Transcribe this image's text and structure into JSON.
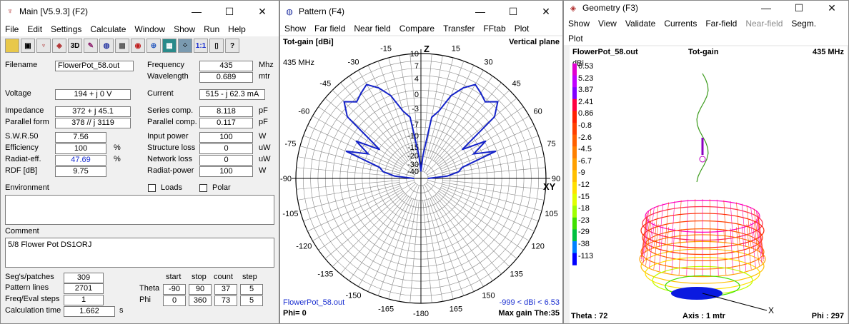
{
  "main": {
    "title": "Main [V5.9.3]   (F2)",
    "menu": [
      "File",
      "Edit",
      "Settings",
      "Calculate",
      "Window",
      "Show",
      "Run",
      "Help"
    ],
    "toolbar_icons": [
      "open-folder-icon",
      "copy-icon",
      "antenna-icon",
      "3d-icon",
      "3d-view-icon",
      "edit-icon",
      "globe-icon",
      "pattern-icon",
      "target-icon",
      "calculator-icon",
      "segment-icon",
      "ratio-icon",
      "book-icon",
      "help-icon"
    ],
    "toolbar_3d": "3D",
    "toolbar_ratio": "1:1",
    "toolbar_help": "?",
    "filename_label": "Filename",
    "filename": "FlowerPot_58.out",
    "frequency_label": "Frequency",
    "frequency": "435",
    "frequency_unit": "Mhz",
    "wavelength_label": "Wavelength",
    "wavelength": "0.689",
    "wavelength_unit": "mtr",
    "voltage_label": "Voltage",
    "voltage": "194 + j 0 V",
    "current_label": "Current",
    "current": "515 - j 62.3 mA",
    "impedance_label": "Impedance",
    "impedance": "372 + j 45.1",
    "series_label": "Series comp.",
    "series": "8.118",
    "series_unit": "pF",
    "parallel_label": "Parallel form",
    "parallel": "378 // j 3119",
    "parallel_comp_label": "Parallel comp.",
    "parallel_comp": "0.117",
    "parallel_comp_unit": "pF",
    "swr_label": "S.W.R.50",
    "swr": "7.56",
    "input_power_label": "Input power",
    "input_power": "100",
    "input_power_unit": "W",
    "efficiency_label": "Efficiency",
    "efficiency": "100",
    "pct1": "%",
    "structure_loss_label": "Structure loss",
    "structure_loss": "0",
    "structure_loss_unit": "uW",
    "radiat_eff_label": "Radiat-eff.",
    "radiat_eff": "47.69",
    "pct2": "%",
    "network_loss_label": "Network loss",
    "network_loss": "0",
    "network_loss_unit": "uW",
    "rdf_label": "RDF [dB]",
    "rdf": "9.75",
    "radiat_power_label": "Radiat-power",
    "radiat_power": "100",
    "radiat_power_unit": "W",
    "environment_label": "Environment",
    "loads_label": "Loads",
    "polar_label": "Polar",
    "comment_label": "Comment",
    "comment": "5/8 Flower Pot DS1ORJ",
    "segs_label": "Seg's/patches",
    "segs": "309",
    "pattern_lines_label": "Pattern lines",
    "pattern_lines": "2701",
    "freq_steps_label": "Freq/Eval steps",
    "freq_steps": "1",
    "calc_time_label": "Calculation time",
    "calc_time": "1.662",
    "calc_time_unit": "s",
    "col_start": "start",
    "col_stop": "stop",
    "col_count": "count",
    "col_step": "step",
    "theta_label": "Theta",
    "theta": [
      "-90",
      "90",
      "37",
      "5"
    ],
    "phi_label": "Phi",
    "phi": [
      "0",
      "360",
      "73",
      "5"
    ]
  },
  "pattern": {
    "title": "Pattern    (F4)",
    "menu": [
      "Show",
      "Far field",
      "Near field",
      "Compare",
      "Transfer",
      "FFtab",
      "Plot"
    ],
    "gain_label": "Tot-gain [dBi]",
    "plane_label": "Vertical plane",
    "freq": "435 MHz",
    "z_label": "Z",
    "xy_label": "XY",
    "file": "FlowerPot_58.out",
    "range": "-999 < dBi < 6.53",
    "phi": "Phi= 0",
    "max_gain": "Max gain The:35",
    "angle_labels": [
      "-15",
      "15",
      "-30",
      "30",
      "-45",
      "45",
      "-60",
      "60",
      "-75",
      "75",
      "-90",
      "90",
      "-105",
      "105",
      "-120",
      "120",
      "-135",
      "135",
      "-150",
      "150",
      "-165",
      "165",
      "-180"
    ],
    "ring_labels": [
      "10",
      "7",
      "4",
      "0",
      "-3",
      "-7",
      "-10",
      "-15",
      "-20",
      "-30",
      "-40"
    ]
  },
  "geometry": {
    "title": "Geometry   (F3)",
    "menu": [
      "Show",
      "View",
      "Validate",
      "Currents",
      "Far-field",
      "Near-field",
      "Segm."
    ],
    "menu_disabled": "Near-field",
    "menu2": "Plot",
    "file": "FlowerPot_58.out",
    "gain": "Tot-gain",
    "freq": "435 MHz",
    "unit": "dBi",
    "scale": [
      "6.53",
      "5.23",
      "3.87",
      "2.41",
      "0.86",
      "-0.8",
      "-2.6",
      "-4.5",
      "-6.7",
      "-9",
      "-12",
      "-15",
      "-18",
      "-23",
      "-29",
      "-38",
      "-113"
    ],
    "theta": "Theta : 72",
    "axis": "Axis : 1 mtr",
    "phi": "Phi : 297",
    "x_label": "X"
  },
  "chart_data": {
    "type": "polar",
    "title": "Tot-gain [dBi]",
    "plane": "Vertical plane",
    "unit": "dBi",
    "angles_deg": [
      -90,
      -85,
      -80,
      -75,
      -70,
      -65,
      -60,
      -55,
      -50,
      -45,
      -40,
      -35,
      -30,
      -25,
      -20,
      -15,
      -10,
      -5,
      0,
      5,
      10,
      15,
      20,
      25,
      30,
      35,
      40,
      45,
      50,
      55,
      60,
      65,
      70,
      75,
      80,
      85,
      90
    ],
    "gain_dbi": [
      -40,
      -18,
      -12,
      -10,
      -1,
      -6,
      -2,
      -8,
      3,
      6,
      4,
      5,
      6,
      4,
      1,
      -3,
      -5,
      -20,
      -40,
      -20,
      -5,
      -3,
      1,
      4,
      6,
      5,
      4,
      6,
      3,
      -8,
      -2,
      -6,
      -1,
      -10,
      -12,
      -18,
      -40
    ],
    "ring_values_dbi": [
      10,
      7,
      4,
      0,
      -3,
      -7,
      -10,
      -15,
      -20,
      -30,
      -40
    ],
    "range": [
      -40,
      10
    ]
  }
}
